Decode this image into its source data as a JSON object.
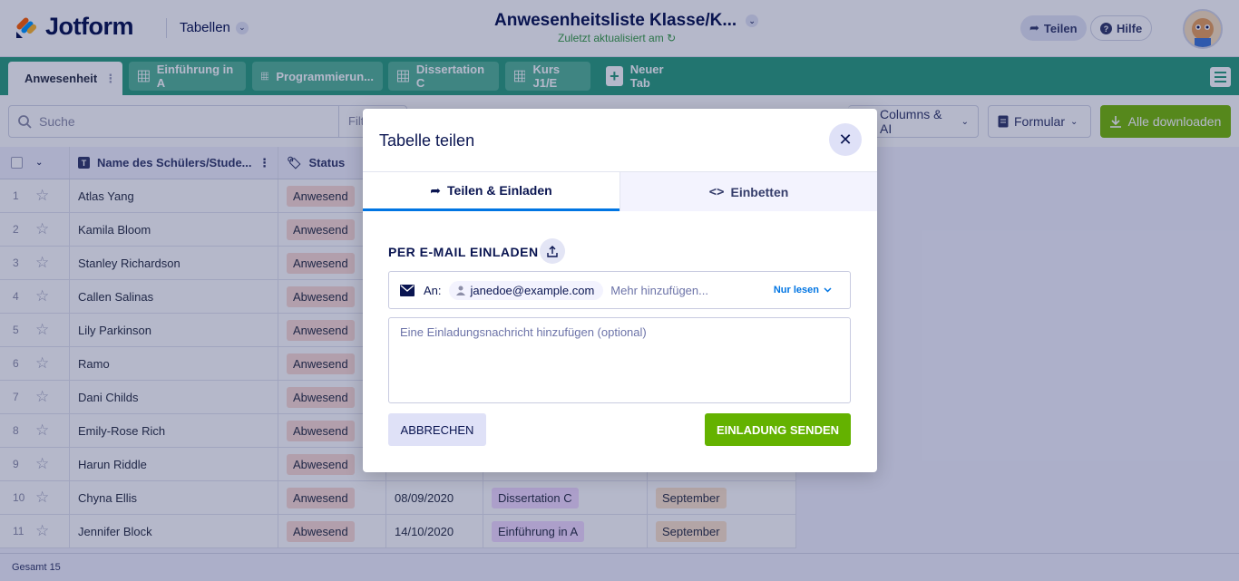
{
  "header": {
    "app_name": "Jotform",
    "section": "Tabellen",
    "title": "Anwesenheitsliste Klasse/K...",
    "subtitle": "Zuletzt aktualisiert am",
    "share_label": "Teilen",
    "help_label": "Hilfe"
  },
  "tabs": [
    {
      "label": "Anwesenheit",
      "active": true
    },
    {
      "label": "Einführung in A"
    },
    {
      "label": "Programmierun..."
    },
    {
      "label": "Dissertation C"
    },
    {
      "label": "Kurs J1/E"
    }
  ],
  "new_tab_label": "Neuer Tab",
  "toolbar": {
    "search_placeholder": "Suche",
    "filter_label": "Filt",
    "columns_label": "Columns & AI",
    "form_label": "Formular",
    "download_label": "Alle downloaden"
  },
  "table": {
    "columns": [
      "Name des Schülers/Stude...",
      "Status"
    ],
    "rows": [
      {
        "num": "1",
        "name": "Atlas Yang",
        "status": "Anwesend"
      },
      {
        "num": "2",
        "name": "Kamila Bloom",
        "status": "Anwesend"
      },
      {
        "num": "3",
        "name": "Stanley Richardson",
        "status": "Anwesend"
      },
      {
        "num": "4",
        "name": "Callen Salinas",
        "status": "Abwesend"
      },
      {
        "num": "5",
        "name": "Lily Parkinson",
        "status": "Anwesend"
      },
      {
        "num": "6",
        "name": "Ramo",
        "status": "Anwesend"
      },
      {
        "num": "7",
        "name": "Dani Childs",
        "status": "Abwesend"
      },
      {
        "num": "8",
        "name": "Emily-Rose Rich",
        "status": "Abwesend"
      },
      {
        "num": "9",
        "name": "Harun Riddle",
        "status": "Abwesend"
      },
      {
        "num": "10",
        "name": "Chyna Ellis",
        "status": "Anwesend",
        "date": "08/09/2020",
        "course": "Dissertation C",
        "month": "September"
      },
      {
        "num": "11",
        "name": "Jennifer Block",
        "status": "Abwesend",
        "date": "14/10/2020",
        "course": "Einführung in A",
        "month": "September"
      }
    ],
    "total_label": "Gesamt 15"
  },
  "modal": {
    "title": "Tabelle teilen",
    "tab_share": "Teilen & Einladen",
    "tab_embed": "Einbetten",
    "section_label": "PER E-MAIL EINLADEN",
    "to_label": "An:",
    "recipient": "janedoe@example.com",
    "more_placeholder": "Mehr hinzufügen...",
    "permission": "Nur lesen",
    "message_placeholder": "Eine Einladungsnachricht hinzufügen (optional)",
    "cancel_label": "ABBRECHEN",
    "send_label": "EINLADUNG SENDEN"
  },
  "colors": {
    "brand_navy": "#0a1551",
    "tab_green": "#2d9f7f",
    "send_green": "#64b200",
    "accent_blue": "#0075e3"
  }
}
